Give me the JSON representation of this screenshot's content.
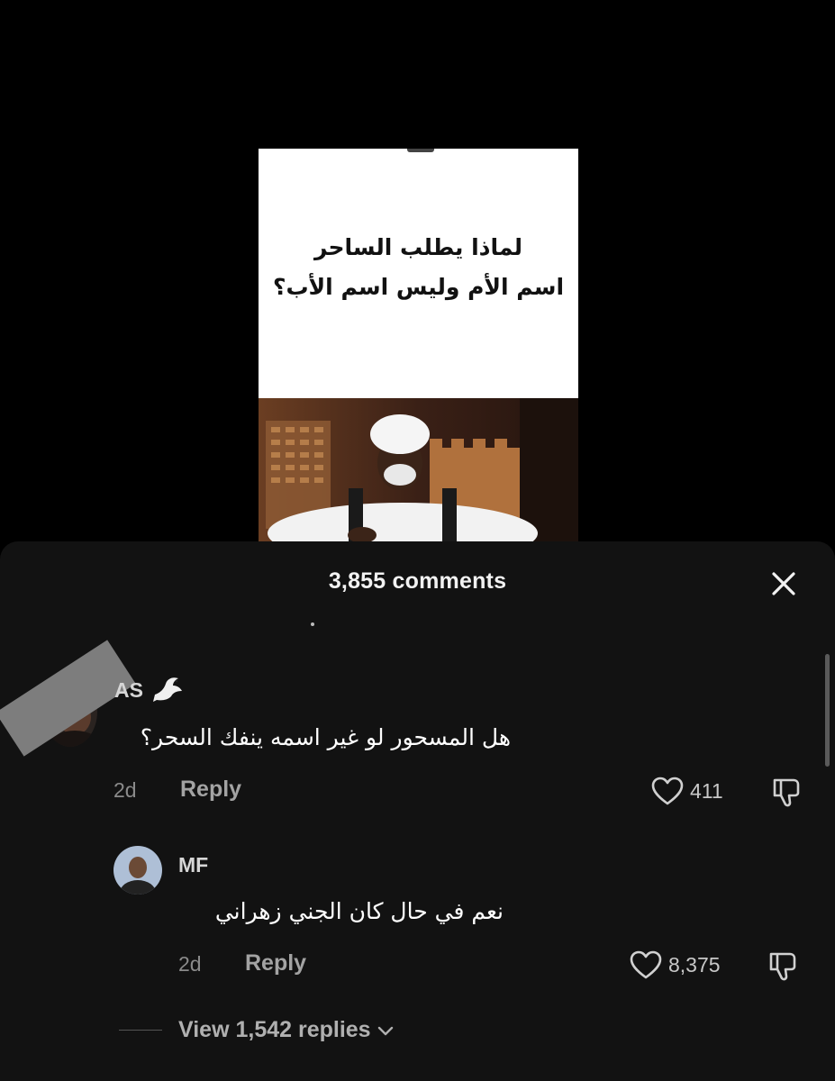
{
  "video": {
    "title_line1": "لماذا يطلب الساحر",
    "title_line2": "اسم الأم وليس اسم الأب؟"
  },
  "comments_panel": {
    "header": "3,855 comments",
    "close_icon": "close-icon"
  },
  "comments": [
    {
      "username": "AS",
      "badge_icon": "dove-icon",
      "text": "هل المسحور لو غير اسمه ينفك السحر؟",
      "time": "2d",
      "reply_label": "Reply",
      "likes": "411"
    },
    {
      "username": "MF",
      "text": "نعم في حال كان الجني زهراني",
      "time": "2d",
      "reply_label": "Reply",
      "likes": "8,375"
    }
  ],
  "view_replies": {
    "label": "View 1,542 replies",
    "icon": "chevron-down-icon"
  },
  "colors": {
    "background": "#000000",
    "sheet": "#121212",
    "text_primary": "#ffffff",
    "text_secondary": "#8a8a8a"
  }
}
